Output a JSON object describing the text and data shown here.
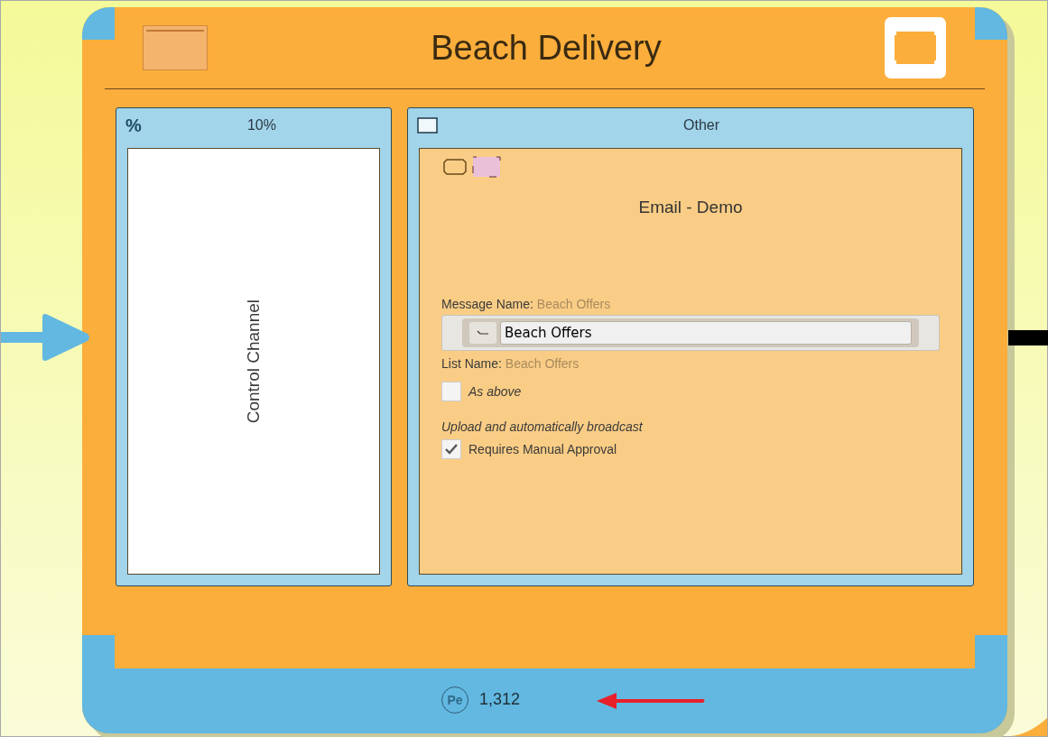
{
  "title": "Beach Delivery",
  "left_panel": {
    "icon": "%",
    "label": "10%",
    "body": "Control Channel"
  },
  "right_panel": {
    "label": "Other",
    "card": {
      "title": "Email - Demo",
      "message_name": {
        "label": "Message Name:",
        "value": "Beach Offers"
      },
      "input": {
        "value": "Beach Offers"
      },
      "list_name": {
        "label": "List Name:",
        "value": "Beach Offers"
      },
      "as_above": {
        "label": "As above",
        "checked": false
      },
      "section_label": "Upload and automatically broadcast",
      "approval": {
        "label": "Requires Manual Approval",
        "checked": true
      }
    }
  },
  "footer": {
    "badge": "Pe",
    "count": "1,312"
  }
}
